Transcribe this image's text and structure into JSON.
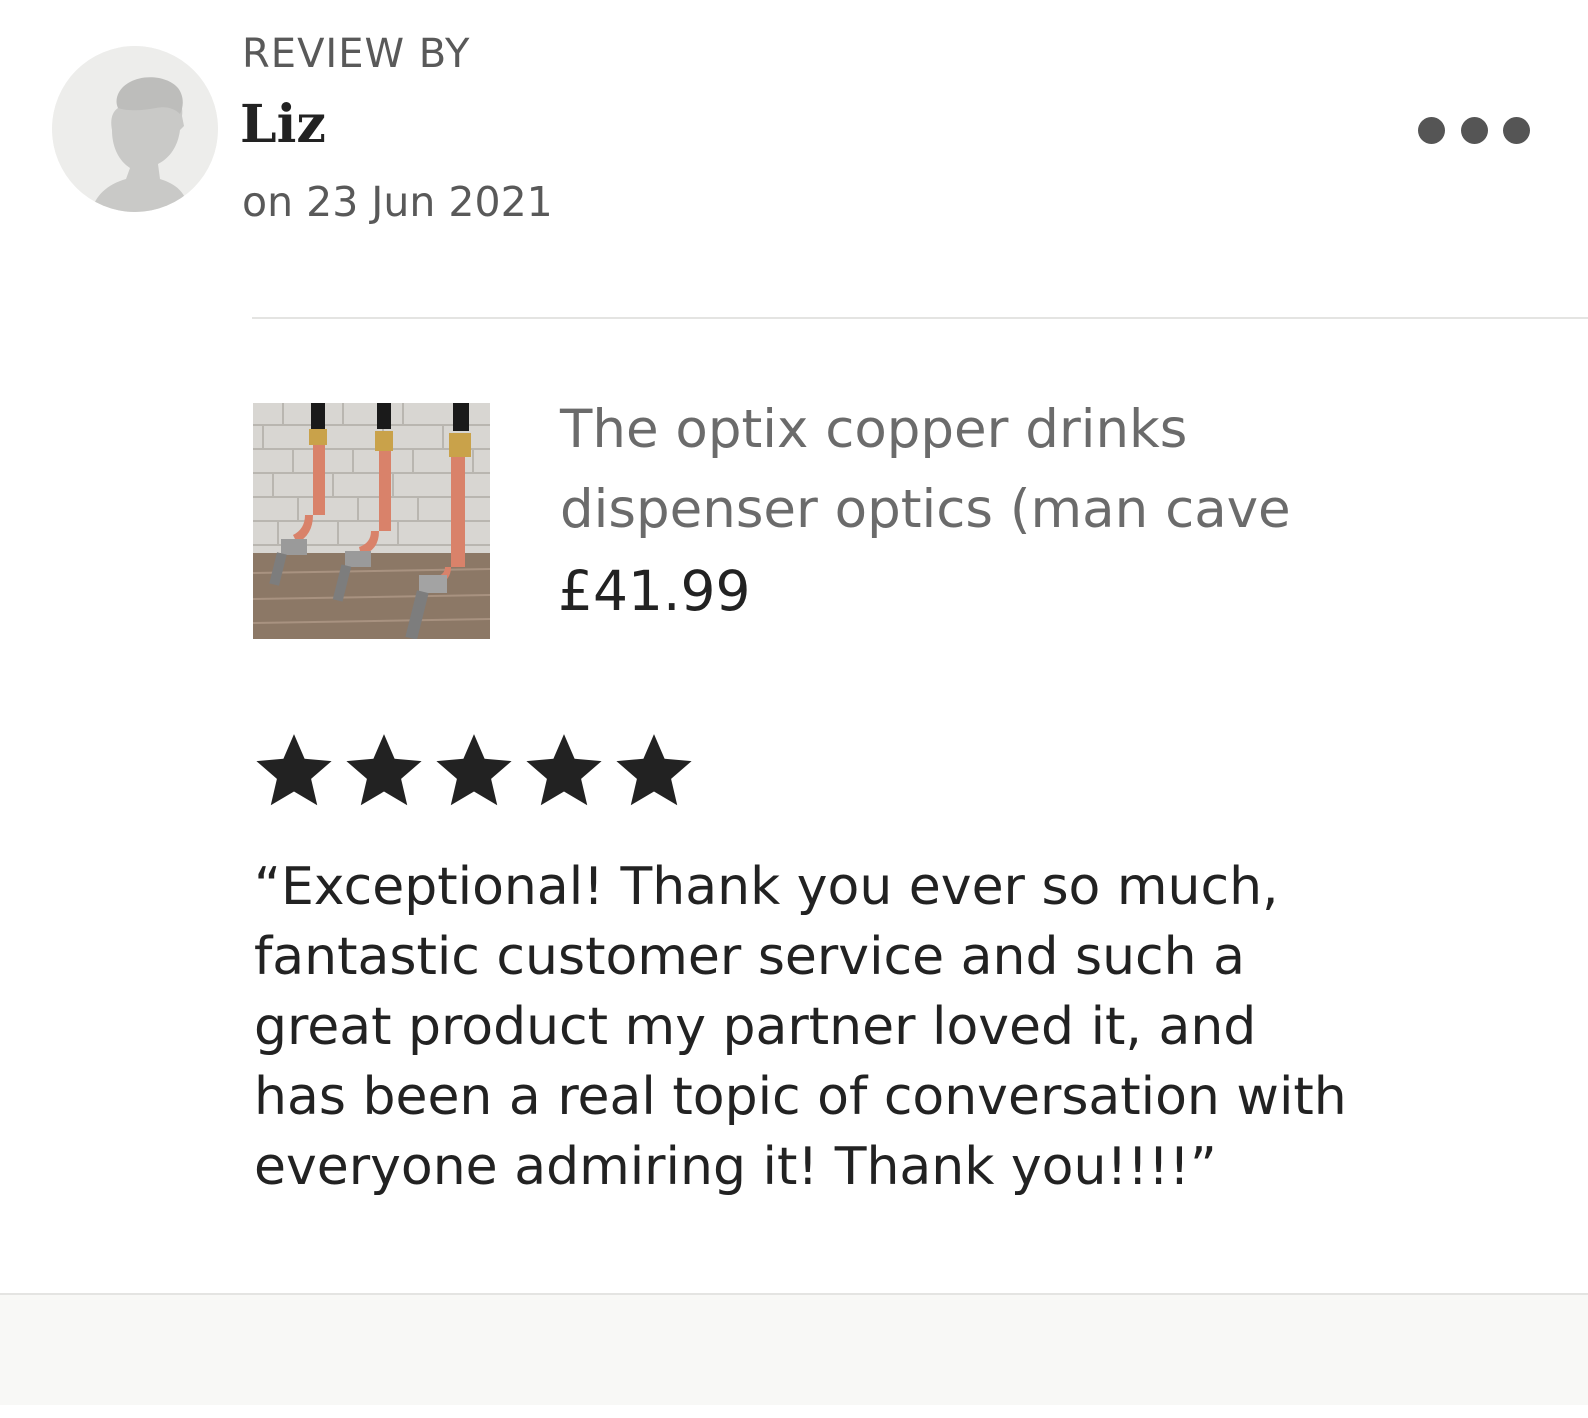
{
  "review": {
    "label": "REVIEW BY",
    "reviewer_name": "Liz",
    "date": "on 23 Jun 2021",
    "more_icon": "more-horizontal-icon"
  },
  "product": {
    "title_lines": [
      "The optix copper drinks",
      "dispenser optics (man cave"
    ],
    "price": "£41.99"
  },
  "rating": {
    "value": 5,
    "max": 5,
    "star_color": "#222222"
  },
  "review_text_lines": [
    "“Exceptional! Thank you ever so much,",
    "fantastic customer service and such a",
    "great product my partner loved it, and",
    "has been a real topic of conversation with",
    "everyone admiring it! Thank you!!!!”"
  ]
}
